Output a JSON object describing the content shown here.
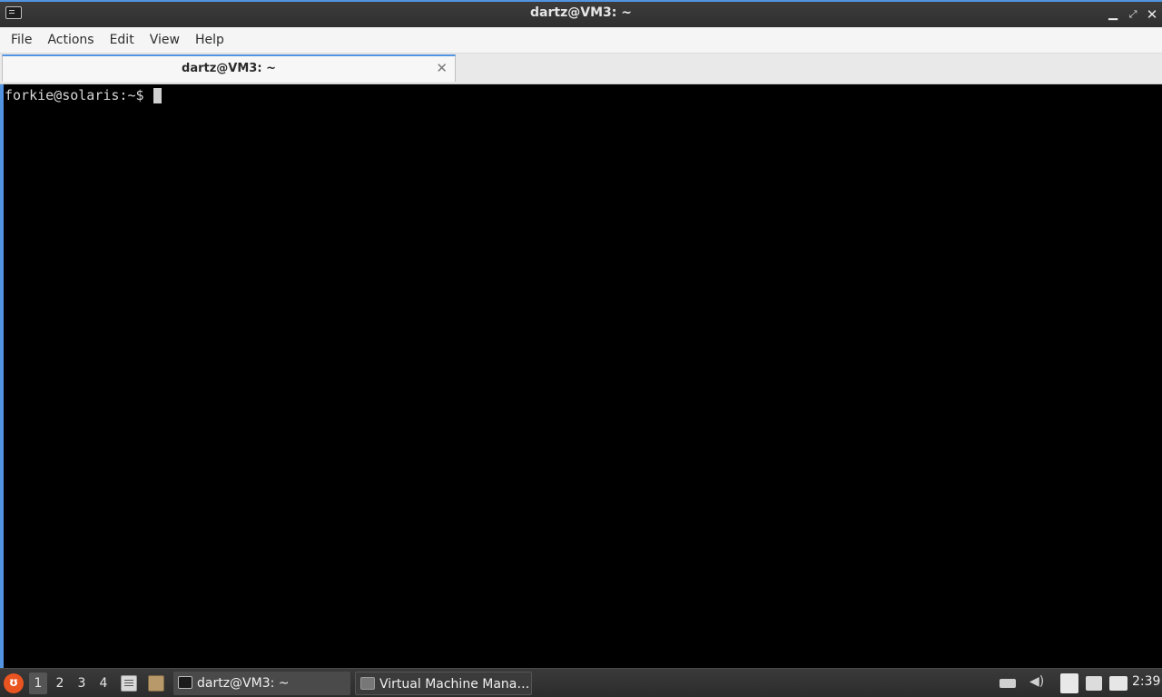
{
  "window": {
    "title": "dartz@VM3: ~",
    "controls": {
      "minimize": "▁",
      "maximize": "⤢",
      "close": "✕"
    }
  },
  "menu": {
    "items": [
      "File",
      "Actions",
      "Edit",
      "View",
      "Help"
    ]
  },
  "tabs": [
    {
      "label": "dartz@VM3: ~",
      "close": "✕"
    }
  ],
  "terminal": {
    "prompt": "forkie@solaris:~$"
  },
  "taskbar": {
    "workspaces": [
      "1",
      "2",
      "3",
      "4"
    ],
    "active_workspace": "1",
    "tasks": [
      {
        "label": "dartz@VM3: ~",
        "icon": "terminal-icon"
      },
      {
        "label": "Virtual Machine Mana…",
        "icon": "virt-manager-icon"
      }
    ],
    "clock": "2:39"
  },
  "colors": {
    "accent": "#5294e2",
    "terminal_bg": "#000000",
    "titlebar_bg": "#353535",
    "menu_logo": "#e95420"
  }
}
